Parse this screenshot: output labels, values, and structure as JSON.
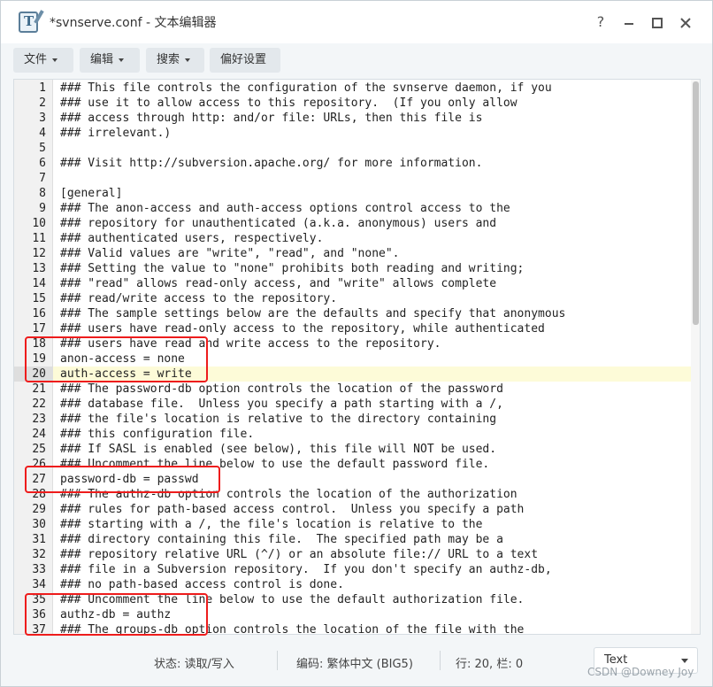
{
  "window": {
    "title": "*svnserve.conf - 文本编辑器",
    "icon": "text-editor-icon",
    "controls": {
      "help": "?",
      "minimize": "minimize-icon",
      "maximize": "maximize-icon",
      "close": "close-icon"
    }
  },
  "toolbar": {
    "file_label": "文件",
    "edit_label": "编辑",
    "search_label": "搜索",
    "prefs_label": "偏好设置"
  },
  "editor": {
    "current_line": 20,
    "lines": [
      {
        "n": "1",
        "text": "### This file controls the configuration of the svnserve daemon, if you"
      },
      {
        "n": "2",
        "text": "### use it to allow access to this repository.  (If you only allow"
      },
      {
        "n": "3",
        "text": "### access through http: and/or file: URLs, then this file is"
      },
      {
        "n": "4",
        "text": "### irrelevant.)"
      },
      {
        "n": "5",
        "text": ""
      },
      {
        "n": "6",
        "text": "### Visit http://subversion.apache.org/ for more information."
      },
      {
        "n": "7",
        "text": ""
      },
      {
        "n": "8",
        "text": "[general]"
      },
      {
        "n": "9",
        "text": "### The anon-access and auth-access options control access to the"
      },
      {
        "n": "10",
        "text": "### repository for unauthenticated (a.k.a. anonymous) users and"
      },
      {
        "n": "11",
        "text": "### authenticated users, respectively."
      },
      {
        "n": "12",
        "text": "### Valid values are \"write\", \"read\", and \"none\"."
      },
      {
        "n": "13",
        "text": "### Setting the value to \"none\" prohibits both reading and writing;"
      },
      {
        "n": "14",
        "text": "### \"read\" allows read-only access, and \"write\" allows complete"
      },
      {
        "n": "15",
        "text": "### read/write access to the repository."
      },
      {
        "n": "16",
        "text": "### The sample settings below are the defaults and specify that anonymous"
      },
      {
        "n": "17",
        "text": "### users have read-only access to the repository, while authenticated"
      },
      {
        "n": "18",
        "text": "### users have read and write access to the repository."
      },
      {
        "n": "19",
        "text": "anon-access = none"
      },
      {
        "n": "20",
        "text": "auth-access = write"
      },
      {
        "n": "21",
        "text": "### The password-db option controls the location of the password"
      },
      {
        "n": "22",
        "text": "### database file.  Unless you specify a path starting with a /,"
      },
      {
        "n": "23",
        "text": "### the file's location is relative to the directory containing"
      },
      {
        "n": "24",
        "text": "### this configuration file."
      },
      {
        "n": "25",
        "text": "### If SASL is enabled (see below), this file will NOT be used."
      },
      {
        "n": "26",
        "text": "### Uncomment the line below to use the default password file."
      },
      {
        "n": "27",
        "text": "password-db = passwd"
      },
      {
        "n": "28",
        "text": "### The authz-db option controls the location of the authorization"
      },
      {
        "n": "29",
        "text": "### rules for path-based access control.  Unless you specify a path"
      },
      {
        "n": "30",
        "text": "### starting with a /, the file's location is relative to the"
      },
      {
        "n": "31",
        "text": "### directory containing this file.  The specified path may be a"
      },
      {
        "n": "32",
        "text": "### repository relative URL (^/) or an absolute file:// URL to a text"
      },
      {
        "n": "33",
        "text": "### file in a Subversion repository.  If you don't specify an authz-db,"
      },
      {
        "n": "34",
        "text": "### no path-based access control is done."
      },
      {
        "n": "35",
        "text": "### Uncomment the line below to use the default authorization file."
      },
      {
        "n": "36",
        "text": "authz-db = authz"
      },
      {
        "n": "37",
        "text": "### The groups-db option controls the location of the file with the"
      }
    ]
  },
  "status": {
    "state": "状态: 读取/写入",
    "encoding": "编码: 繁体中文 (BIG5)",
    "position": "行: 20, 栏: 0",
    "mode": "Text"
  },
  "watermark": "CSDN @Downey Joy",
  "colors": {
    "highlight_box": "#ee1c1c",
    "current_line": "#fdfbd8"
  }
}
